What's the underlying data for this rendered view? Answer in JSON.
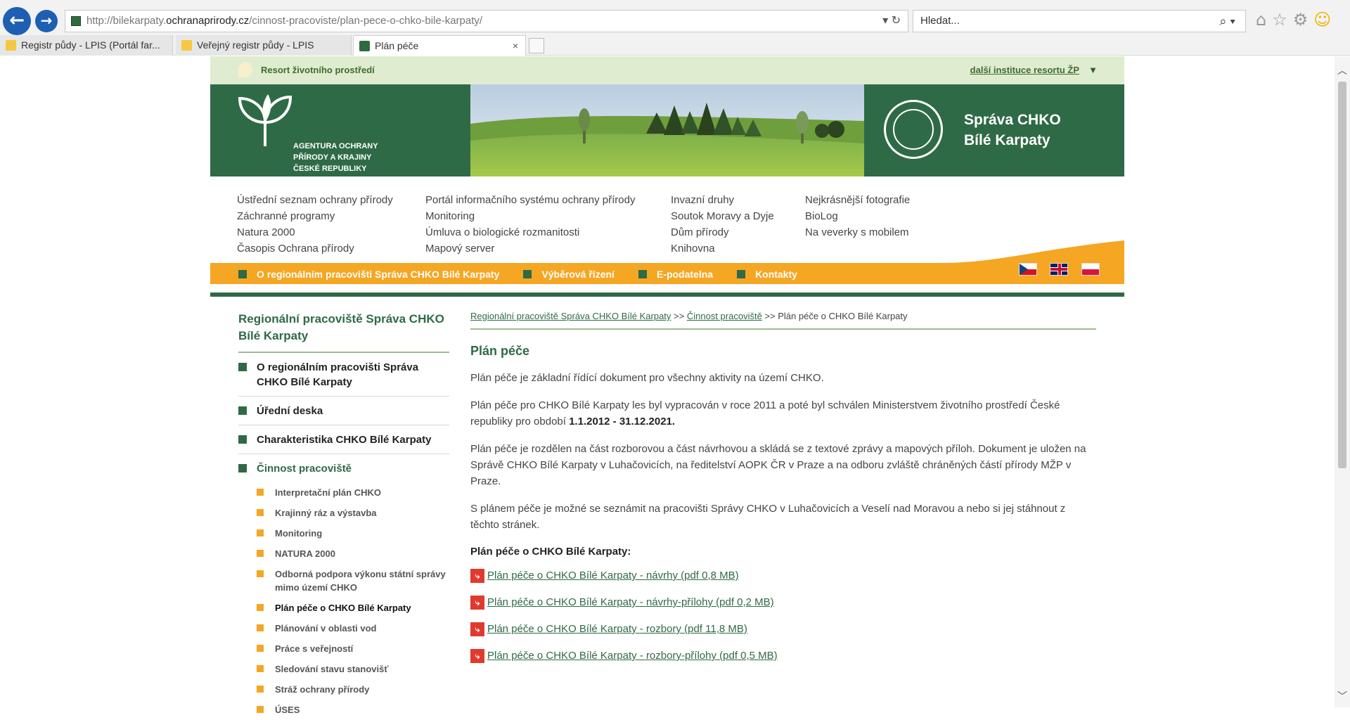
{
  "browser": {
    "url_prefix": "http://bilekarpaty.",
    "url_domain": "ochranaprirody.cz",
    "url_path": "/cinnost-pracoviste/plan-pece-o-chko-bile-karpaty/",
    "search_placeholder": "Hledat...",
    "tabs": [
      {
        "label": "Registr půdy - LPIS (Portál far..."
      },
      {
        "label": "Veřejný registr půdy - LPIS"
      },
      {
        "label": "Plán péče"
      }
    ]
  },
  "site": {
    "resort_label": "Resort životního prostředí",
    "other_institutions": "další instituce resortu ŽP",
    "logo_text": [
      "AGENTURA OCHRANY",
      "PŘÍRODY A KRAJINY",
      "ČESKÉ REPUBLIKY"
    ],
    "org_title": [
      "Správa CHKO",
      "Bílé Karpaty"
    ],
    "links_col1": [
      "Ústřední seznam ochrany přírody",
      "Záchranné programy",
      "Natura 2000",
      "Časopis Ochrana přírody"
    ],
    "links_col2": [
      "Portál informačního systému ochrany přírody",
      "Monitoring",
      "Úmluva o biologické rozmanitosti",
      "Mapový server"
    ],
    "links_col3": [
      "Invazní druhy",
      "Soutok Moravy a Dyje",
      "Dům přírody",
      "Knihovna"
    ],
    "links_col4": [
      "Nejkrásnější fotografie",
      "BioLog",
      "Na veverky s mobilem"
    ],
    "main_menu": [
      "O regionálním pracovišti Správa CHKO Bílé Karpaty",
      "Výběrová řízení",
      "E-podatelna",
      "Kontakty"
    ],
    "colors": {
      "green": "#2f6a46",
      "orange": "#f5a623",
      "light_green": "#dfeccf"
    }
  },
  "sidebar": {
    "title": "Regionální pracoviště Správa CHKO Bílé Karpaty",
    "items": [
      {
        "label": "O regionálním pracovišti Správa CHKO Bílé Karpaty"
      },
      {
        "label": "Úřední deska"
      },
      {
        "label": "Charakteristika CHKO Bílé Karpaty"
      },
      {
        "label": "Činnost pracoviště"
      }
    ],
    "subitems": [
      {
        "label": "Interpretační plán CHKO"
      },
      {
        "label": "Krajinný ráz a výstavba"
      },
      {
        "label": "Monitoring"
      },
      {
        "label": "NATURA 2000"
      },
      {
        "label": "Odborná podpora výkonu státní správy mimo území CHKO"
      },
      {
        "label": "Plán péče o CHKO Bílé Karpaty"
      },
      {
        "label": "Plánování v oblasti vod"
      },
      {
        "label": "Práce s veřejností"
      },
      {
        "label": "Sledování stavu stanovišť"
      },
      {
        "label": "Stráž ochrany přírody"
      },
      {
        "label": "ÚSES"
      }
    ]
  },
  "content": {
    "breadcrumb": {
      "link1": "Regionální pracoviště Správa CHKO Bílé Karpaty",
      "sep": ">>",
      "link2": "Činnost pracoviště",
      "current": "Plán péče o CHKO Bílé Karpaty"
    },
    "heading": "Plán péče",
    "p1": "Plán péče je základní řídící dokument pro všechny aktivity na území CHKO.",
    "p2_text": "Plán péče pro CHKO Bílé Karpaty les byl vypracován v roce 2011 a poté byl schválen Ministerstvem životního prostředí České republiky pro období ",
    "p2_bold": "1.1.2012 - 31.12.2021.",
    "p3": "Plán péče je rozdělen na část rozborovou a část návrhovou a skládá se z textové zprávy a mapových příloh. Dokument je uložen na Správě CHKO Bílé Karpaty v Luhačovicích, na ředitelství AOPK ČR v Praze a na odboru zvláště chráněných částí přírody MŽP v Praze.",
    "p4": "S plánem péče je možné se seznámit na pracovišti Správy CHKO v Luhačovicích a Veselí nad Moravou a nebo si jej stáhnout z těchto stránek.",
    "downloads_heading": "Plán péče o CHKO Bílé Karpaty:",
    "downloads": [
      {
        "label": "Plán péče o CHKO Bílé Karpaty - návrhy (pdf 0,8 MB)"
      },
      {
        "label": "Plán péče o CHKO Bílé Karpaty - návrhy-přílohy (pdf 0,2 MB)"
      },
      {
        "label": "Plán péče o CHKO Bílé Karpaty - rozbory (pdf 11,8 MB)"
      },
      {
        "label": "Plán péče o CHKO Bílé Karpaty - rozbory-přílohy (pdf 0,5 MB)"
      }
    ]
  }
}
